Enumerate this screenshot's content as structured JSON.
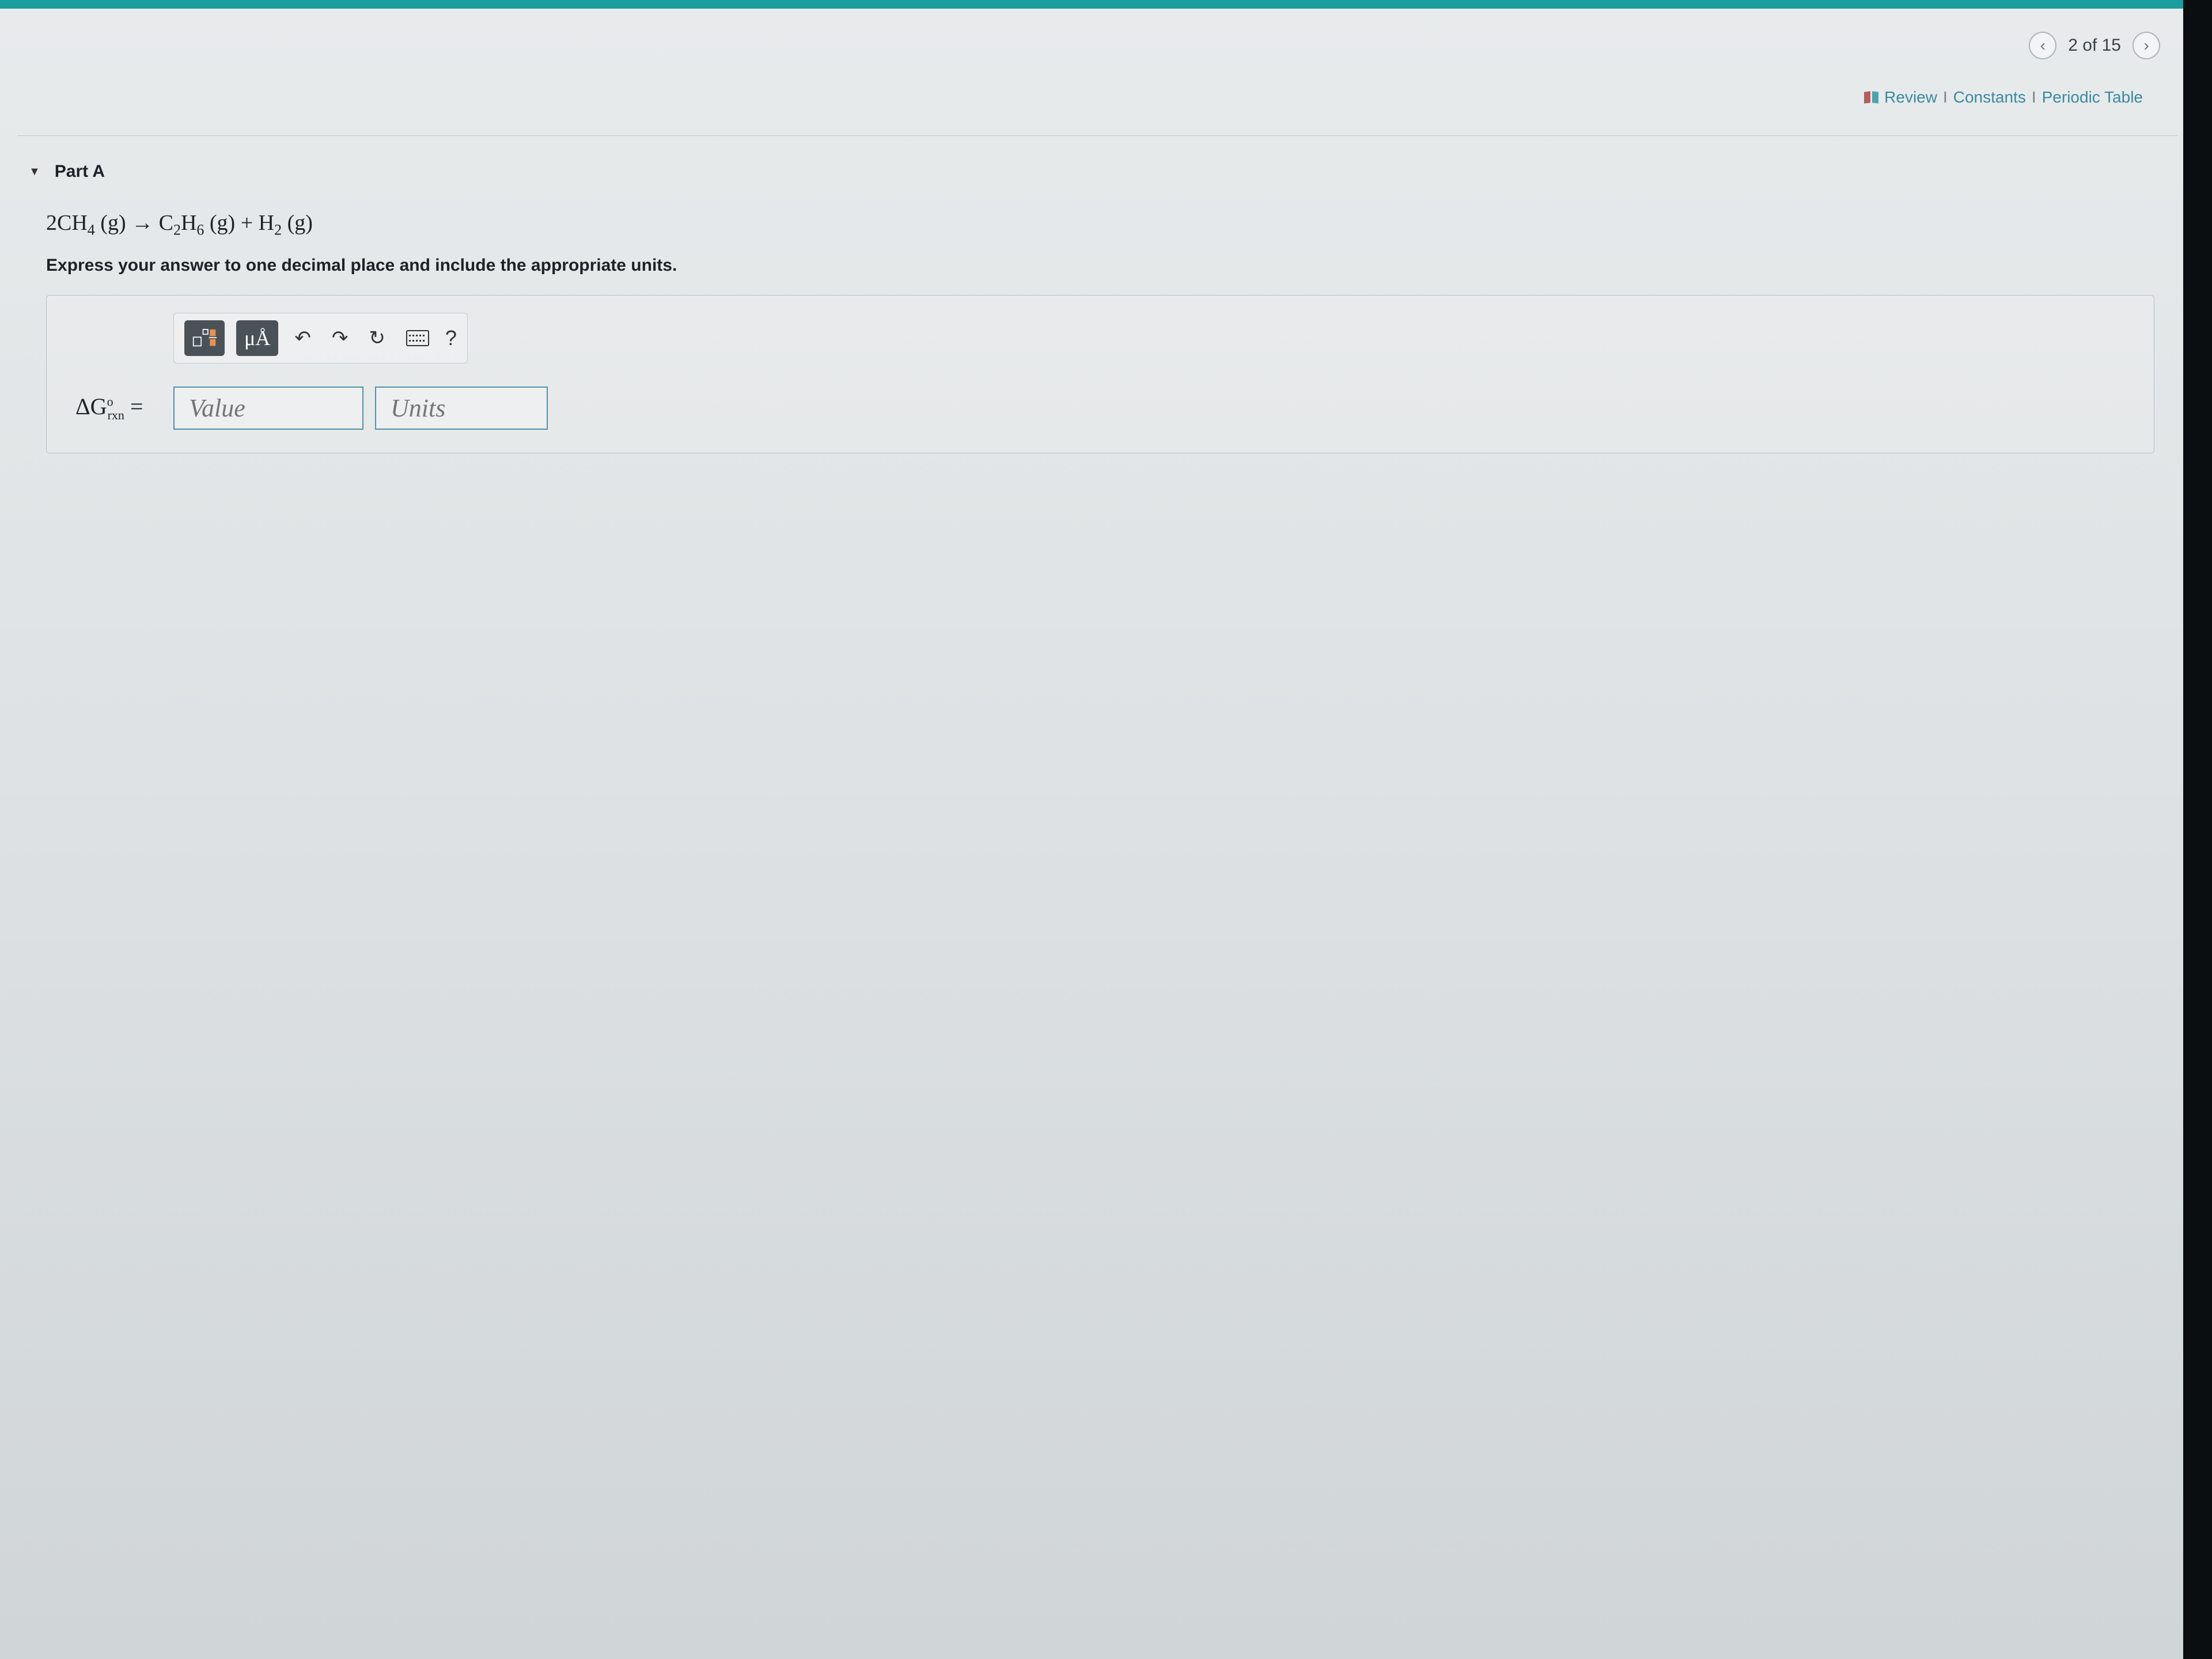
{
  "nav": {
    "prev_icon": "‹",
    "position_text": "2 of 15",
    "next_icon": "›"
  },
  "links": {
    "review": "Review",
    "constants": "Constants",
    "periodic": "Periodic Table",
    "separator": "I"
  },
  "part": {
    "title": "Part A",
    "equation_html": "2CH<span class='sub'>4</span> (g) → C<span class='sub'>2</span>H<span class='sub'>6</span> (g) + H<span class='sub'>2</span> (g)",
    "instruction": "Express your answer to one decimal place and include the appropriate units."
  },
  "toolbar": {
    "mu_a": "μÅ",
    "undo": "↶",
    "redo": "↷",
    "reset": "↻",
    "help": "?"
  },
  "answer": {
    "label_html": "ΔG<span class='sup'>o</span><span class='sub2'>rxn</span> =",
    "value_placeholder": "Value",
    "units_placeholder": "Units"
  }
}
